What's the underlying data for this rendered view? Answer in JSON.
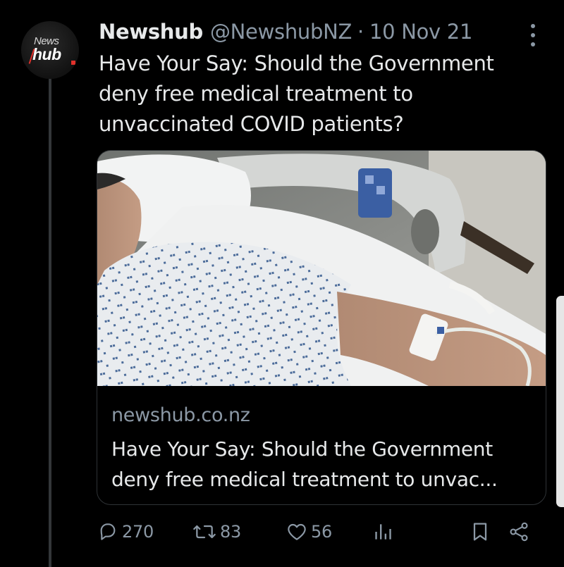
{
  "tweet": {
    "author": {
      "display_name": "Newshub",
      "handle": "@NewshubNZ",
      "avatar_text_top": "News",
      "avatar_text_bottom": "hub"
    },
    "separator": "·",
    "date": "10 Nov 21",
    "text": "Have Your Say: Should the Government deny free medical treatment to unvaccinated COVID patients?",
    "card": {
      "image_description": "Patient in hospital gown lying in hospital bed with IV line in arm",
      "domain": "newshub.co.nz",
      "title": "Have Your Say: Should the Government deny free medical treatment to unvac..."
    },
    "actions": {
      "replies": "270",
      "retweets": "83",
      "likes": "56"
    },
    "icons": {
      "more": "more-vertical-icon",
      "reply": "reply-icon",
      "retweet": "retweet-icon",
      "like": "heart-icon",
      "views": "analytics-icon",
      "bookmark": "bookmark-icon",
      "share": "share-icon"
    },
    "colors": {
      "background": "#000000",
      "text": "#e7e9ea",
      "muted": "#8b98a5",
      "border": "#2f3336",
      "brand_red": "#e0312b"
    }
  }
}
